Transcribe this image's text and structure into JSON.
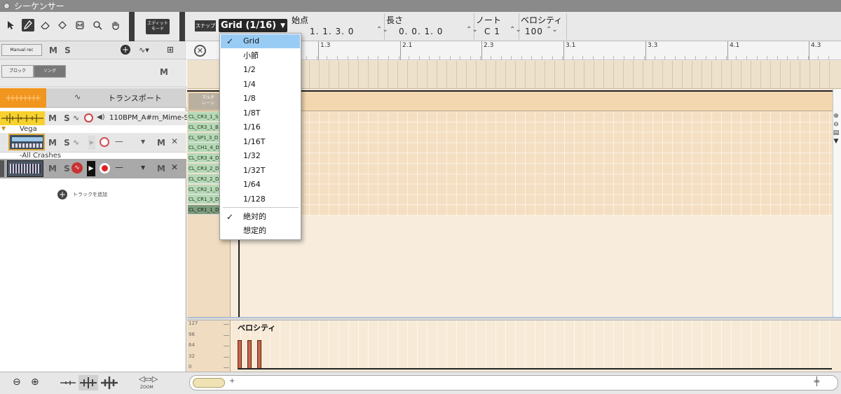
{
  "window": {
    "title": "シーケンサー"
  },
  "toolbar": {
    "edit_mode_line1": "エディット",
    "edit_mode_line2": "モード",
    "snap_label": "スナップ",
    "snap_value": "Grid (1/16)",
    "fields": [
      {
        "label": "始点",
        "value": "1.  1.  3.   0"
      },
      {
        "label": "長さ",
        "value": "0.  0.  1.   0"
      },
      {
        "label": "ノート",
        "value": "C 1"
      },
      {
        "label": "ベロシティ",
        "value": "100"
      }
    ]
  },
  "snap_menu": {
    "items": [
      "Grid",
      "小節",
      "1/2",
      "1/4",
      "1/8",
      "1/8T",
      "1/16",
      "1/16T",
      "1/32",
      "1/32T",
      "1/64",
      "1/128"
    ],
    "selected": "Grid",
    "modes": [
      "絶対的",
      "想定的"
    ],
    "selected_mode": "絶対的",
    "check": "✓"
  },
  "left": {
    "manual_rec": "Manual rec",
    "block_label": "ブロック",
    "song_label": "ソング",
    "m_letter": "M",
    "s_letter": "S",
    "ms": "M S",
    "transport_label": "トランスポート",
    "audio_track_name": "110BPM_A#m_Mime-S...",
    "vega_name": "Vega",
    "crash_name": "-All Crashes",
    "add_track": "トラックを追加"
  },
  "ruler": {
    "labels": [
      "1.3",
      "2.1",
      "2.3",
      "3.1",
      "3.3",
      "4.1",
      "4.3"
    ]
  },
  "lane": {
    "line1": "マルチ",
    "line2": "レーン"
  },
  "notes": [
    "CL_CR3_1_S",
    "CL_CR3_1_B",
    "CL_SP1_3_D",
    "CL_CH1_4_D",
    "CL_CR3_4_D",
    "CL_CR3_2_D",
    "CL_CR2_2_D",
    "CL_CR2_1_D",
    "CL_CR1_3_D",
    "CL_CR1_1_D"
  ],
  "velocity": {
    "title": "ベロシティ",
    "scale": [
      "127",
      "96",
      "64",
      "32",
      "0"
    ],
    "values": [
      100,
      100,
      100
    ]
  },
  "bottom": {
    "zoom_label": "ZOOM"
  },
  "colors": {
    "accent_orange": "#f0951e",
    "selected_blue": "#99ccf5",
    "grid_beige": "#f5dfc2",
    "note_green": "#b7d8b7"
  }
}
